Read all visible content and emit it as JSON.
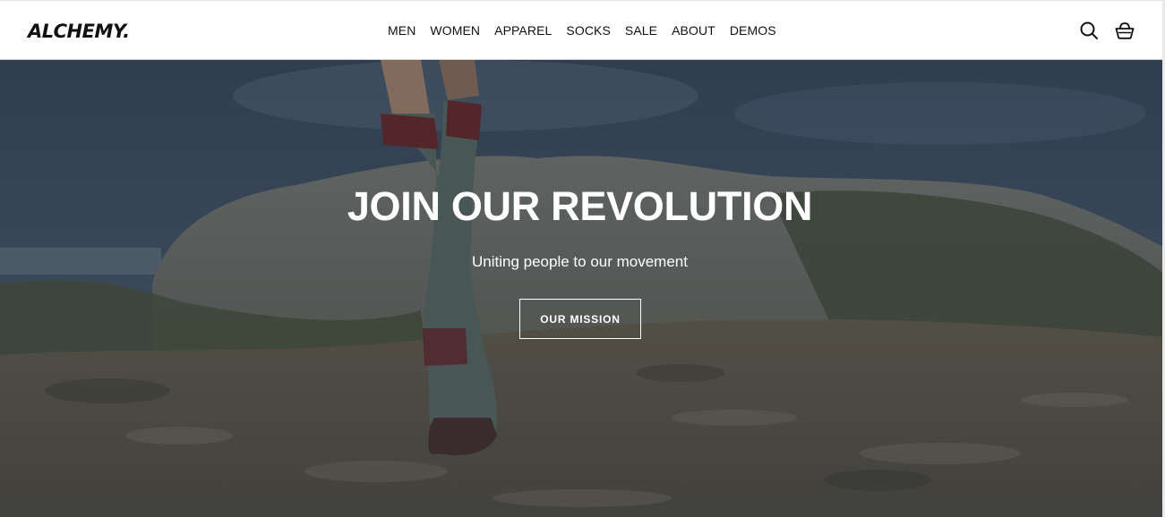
{
  "header": {
    "logo": "ALCHEMY.",
    "nav": [
      "MEN",
      "WOMEN",
      "APPAREL",
      "SOCKS",
      "SALE",
      "ABOUT",
      "DEMOS"
    ],
    "icons": [
      "search-icon",
      "cart-icon"
    ]
  },
  "hero": {
    "title": "JOIN OUR REVOLUTION",
    "subtitle": "Uniting people to our movement",
    "button_label": "OUR MISSION"
  },
  "colors": {
    "header_bg": "#ffffff",
    "text": "#111111",
    "hero_text": "#ffffff"
  }
}
